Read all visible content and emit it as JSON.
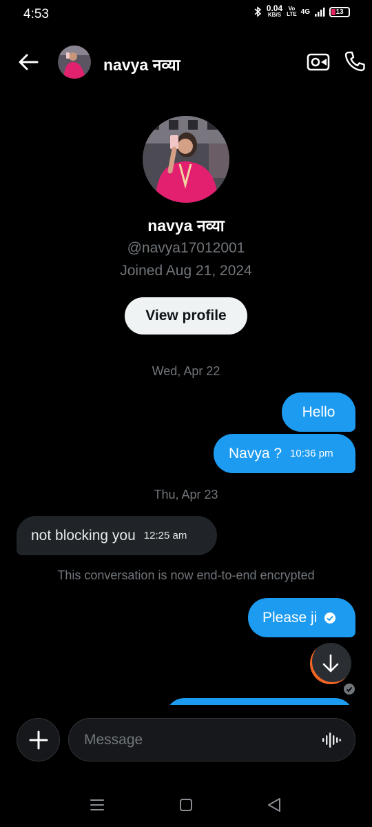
{
  "status_bar": {
    "time": "4:53",
    "net_speed_value": "0.04",
    "net_speed_unit": "KB/S",
    "volte_top": "Vo",
    "volte_bottom": "LTE",
    "network": "4G",
    "battery": "13",
    "icons": [
      "bluetooth-icon",
      "signal-icon",
      "battery-icon"
    ]
  },
  "header": {
    "name": "navya नव्या",
    "icons": [
      "back-arrow-icon",
      "video-call-icon",
      "phone-icon"
    ]
  },
  "profile": {
    "name": "navya नव्या",
    "handle": "@navya17012001",
    "joined": "Joined Aug 21, 2024",
    "view_profile_label": "View profile"
  },
  "conversation": {
    "date_1": "Wed, Apr 22",
    "date_2": "Thu, Apr 23",
    "messages": [
      {
        "direction": "out",
        "text": "Hello",
        "time": ""
      },
      {
        "direction": "out",
        "text": "Navya ?",
        "time": "10:36 pm"
      },
      {
        "direction": "in",
        "text": "not blocking you",
        "time": "12:25 am"
      },
      {
        "direction": "out",
        "text": "Please ji",
        "time": ""
      }
    ],
    "system_notice": "This conversation is now end-to-end encrypted"
  },
  "composer": {
    "placeholder": "Message"
  },
  "colors": {
    "background": "#000000",
    "outgoing_bubble": "#1d9bf0",
    "incoming_bubble": "#202327",
    "muted_text": "#71767b",
    "battery_low": "#e0245e"
  }
}
